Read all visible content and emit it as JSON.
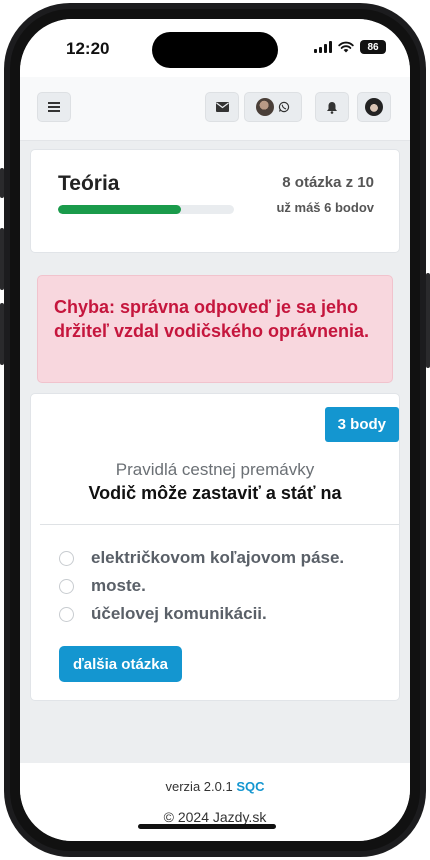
{
  "status_bar": {
    "time": "12:20",
    "battery": "86",
    "icons": [
      "signal-icon",
      "wifi-icon",
      "battery-icon"
    ]
  },
  "navbar": {
    "menu_icon": "hamburger-menu-icon",
    "mail_icon": "envelope-icon",
    "whatsapp_icon": "whatsapp-icon",
    "bell_icon": "bell-icon"
  },
  "progress": {
    "title": "Teória",
    "question_counter": "8 otázka z 10",
    "points_text": "už máš 6 bodov",
    "fraction": 0.7,
    "color": "#1a9b4b"
  },
  "alert": {
    "text": "Chyba: správna odpoveď je sa jeho držiteľ vzdal vodičského oprávnenia."
  },
  "question": {
    "badge": "3 body",
    "category": "Pravidlá cestnej premávky",
    "text": "Vodič môže zastaviť a stáť na",
    "options": [
      "električkovom koľajovom páse.",
      "moste.",
      "účelovej komunikácii."
    ],
    "next_button": "ďalšia otázka"
  },
  "footer": {
    "version_prefix": "verzia 2.0.1",
    "version_link": "SQC",
    "copyright": "© 2024 Jazdy.sk"
  },
  "colors": {
    "accent": "#1496d0",
    "alert_bg": "#f8d7de",
    "alert_text": "#c5163d"
  }
}
